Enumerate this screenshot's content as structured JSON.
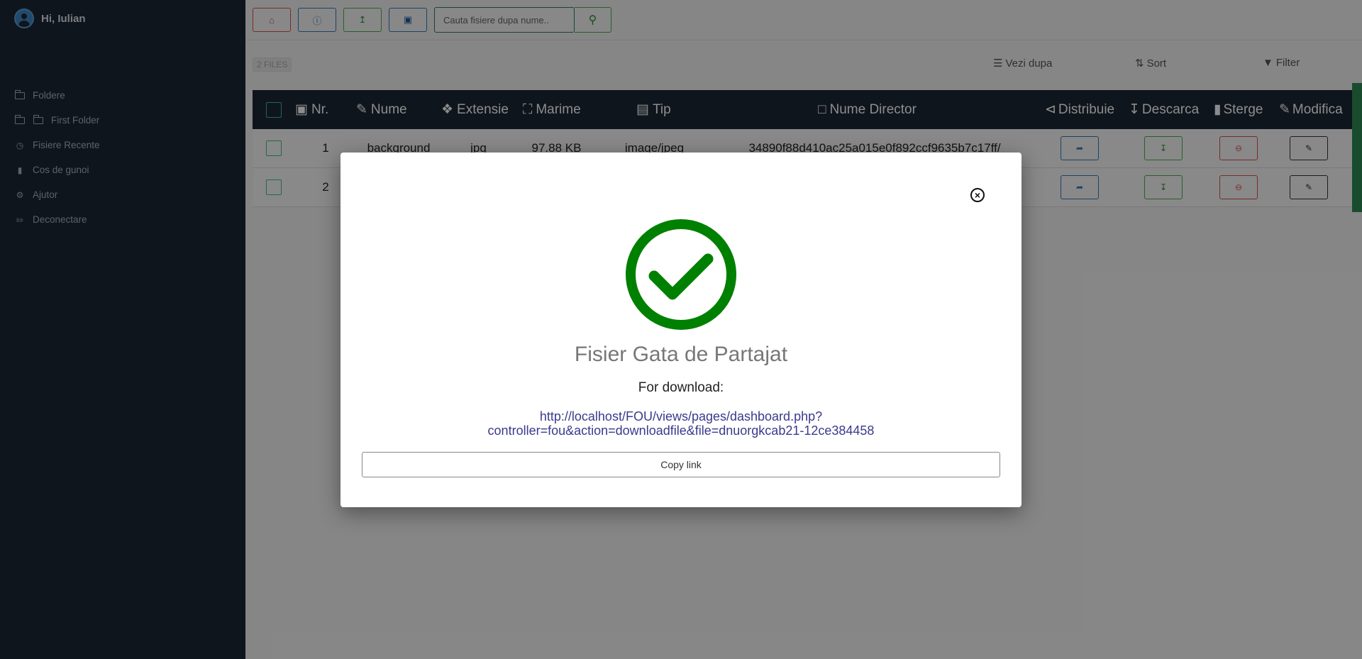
{
  "sidebar": {
    "greeting": "Hi, Iulian",
    "items": [
      {
        "label": "Foldere",
        "icon": "folder-icon"
      },
      {
        "label": "First Folder",
        "icon": "folder-open-icon"
      },
      {
        "label": "Fisiere Recente",
        "icon": "clock-icon"
      },
      {
        "label": "Cos de gunoi",
        "icon": "trash-icon"
      },
      {
        "label": "Ajutor",
        "icon": "ajutor-icon"
      },
      {
        "label": "Deconectare",
        "icon": "sign-out-icon"
      }
    ]
  },
  "toolbar": {
    "search_placeholder": "Cauta fisiere dupa nume..",
    "buttons": [
      "home-icon",
      "help-icon",
      "upload-icon",
      "new-folder-icon",
      "search-icon"
    ]
  },
  "files_count": "2 FILES",
  "view_options": {
    "view_by": "Vezi dupa",
    "sort": "Sort",
    "filter": "Filter"
  },
  "table": {
    "headers": {
      "nr": "Nr.",
      "name": "Nume",
      "ext": "Extensie",
      "size": "Marime",
      "type": "Tip",
      "dir": "Nume Director",
      "share": "Distribuie",
      "download": "Descarca",
      "delete": "Sterge",
      "edit": "Modifica"
    },
    "rows": [
      {
        "nr": "1",
        "name": "background",
        "ext": "jpg",
        "size": "97.88 KB",
        "type": "image/jpeg",
        "dir": "34890f88d410ac25a015e0f892ccf9635b7c17ff/"
      },
      {
        "nr": "2",
        "name": "",
        "ext": "",
        "size": "",
        "type": "",
        "dir": ""
      }
    ]
  },
  "modal": {
    "title": "Fisier Gata de Partajat",
    "subtitle": "For download:",
    "link_line1": "http://localhost/FOU/views/pages/dashboard.php?",
    "link_line2": "controller=fou&action=downloadfile&file=dnuorgkcab21-12ce384458",
    "copy_label": "Copy link",
    "close_icon": "close-icon",
    "success_color": "#008000"
  },
  "colors": {
    "sidebar_bg": "#1c2734",
    "accent_green": "#008000",
    "table_header_bg": "#1c2734"
  }
}
